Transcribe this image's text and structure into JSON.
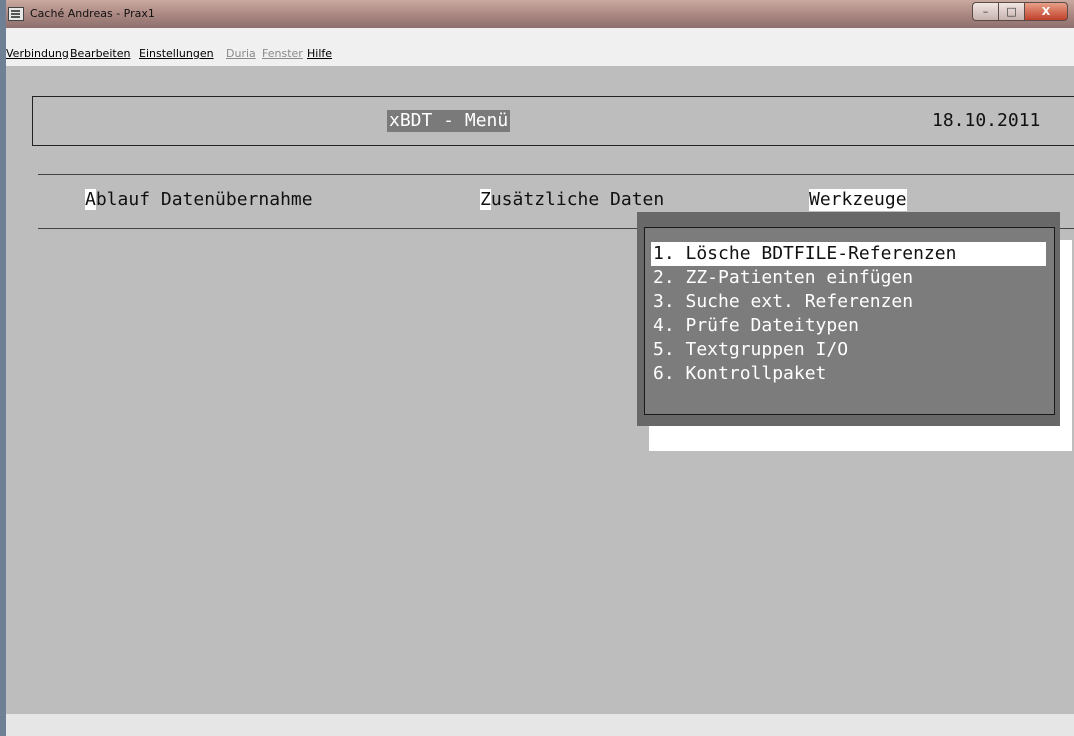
{
  "window": {
    "title": "Caché Andreas - Prax1",
    "buttons": {
      "minimize": "–",
      "maximize": "□",
      "close": "X"
    }
  },
  "menubar": {
    "items": [
      {
        "label": "Verbindung",
        "enabled": true
      },
      {
        "label": "Bearbeiten",
        "enabled": true
      },
      {
        "label": "Einstellungen",
        "enabled": true
      },
      {
        "label": "Duria",
        "enabled": false
      },
      {
        "label": "Fenster",
        "enabled": false
      },
      {
        "label": "Hilfe",
        "enabled": true
      }
    ]
  },
  "screen": {
    "header_title": "xBDT - Menü",
    "header_date": "18.10.2011",
    "top_menu": [
      {
        "hotkey": "A",
        "rest": "blauf Datenübernahme"
      },
      {
        "hotkey": "Z",
        "rest": "usätzliche Daten"
      },
      {
        "label": "Werkzeuge",
        "active": true
      }
    ],
    "dropdown": {
      "items": [
        "1. Lösche BDTFILE-Referenzen",
        "2. ZZ-Patienten einfügen",
        "3. Suche ext. Referenzen",
        "4. Prüfe Dateitypen",
        "5. Textgruppen I/O",
        "6. Kontrollpaket"
      ],
      "selected_index": 0
    }
  },
  "colors": {
    "terminal_bg": "#bdbdbd",
    "highlight": "#ffffff",
    "dropdown_bg": "#7c7c7c",
    "title_highlight": "#7a7a7a"
  }
}
